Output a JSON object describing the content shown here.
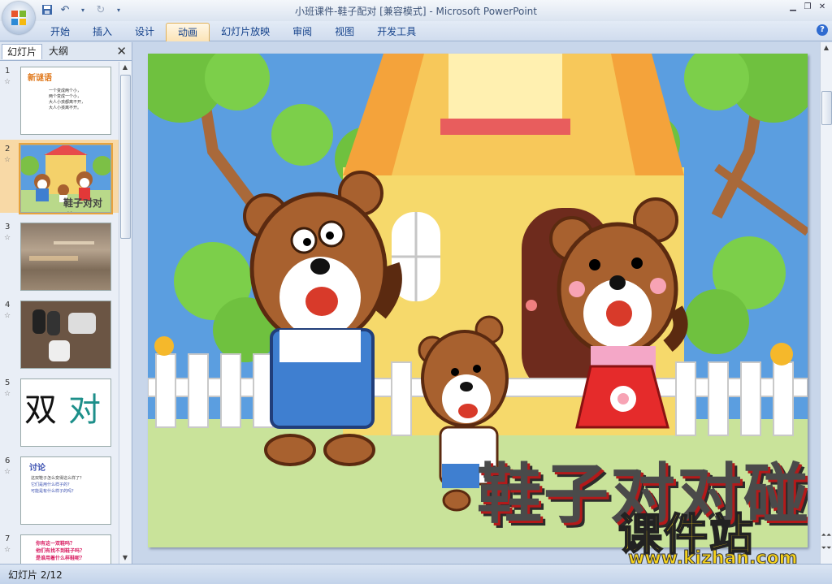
{
  "window": {
    "title": "小班课件-鞋子配对 [兼容模式]",
    "app_name": "Microsoft PowerPoint",
    "separator": " - "
  },
  "ribbon": {
    "tabs": [
      "开始",
      "插入",
      "设计",
      "动画",
      "幻灯片放映",
      "审阅",
      "视图",
      "开发工具"
    ],
    "active_index": 3
  },
  "left_pane": {
    "tabs": [
      "幻灯片",
      "大纲"
    ],
    "close": "✕",
    "thumbnails": [
      {
        "num": "1",
        "title": "新谜语",
        "lines": [
          "一个变成两个小，",
          "两个变成一个小，",
          "大人小孩都离不开，",
          "大人小孩离不开。"
        ]
      },
      {
        "num": "2",
        "caption": "鞋子对对碰"
      },
      {
        "num": "3"
      },
      {
        "num": "4"
      },
      {
        "num": "5",
        "words": [
          "双",
          "对"
        ]
      },
      {
        "num": "6",
        "title": "讨论",
        "lines": [
          "这双鞋子怎么变得这么样了？",
          "它们是用什么样子的？",
          "可能是有什么样子的吗？"
        ]
      },
      {
        "num": "7",
        "lines": [
          "你有这一双鞋吗？",
          "他们有找不到鞋子吗？",
          "是谁用着什么样鞋呢？"
        ]
      }
    ]
  },
  "slide": {
    "title_text": "鞋子对对碰",
    "watermark_main": "课件站",
    "watermark_url": "www.kjzhan.com"
  },
  "status": {
    "slide_info": "幻灯片 2/12"
  },
  "colors": {
    "accent": "#e8a33d",
    "ribbon_text": "#15428b",
    "sky": "#5b9ee0"
  }
}
